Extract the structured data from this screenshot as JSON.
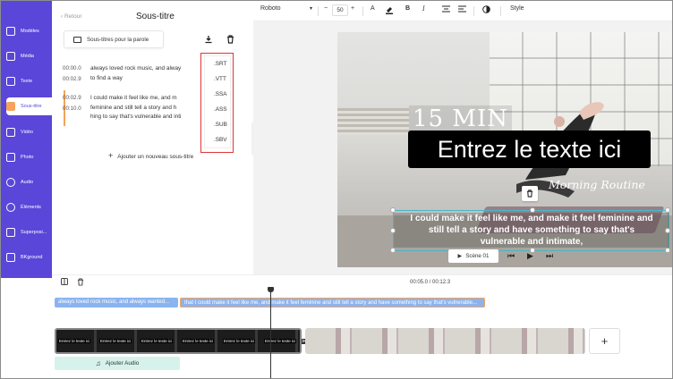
{
  "sidebar": {
    "items": [
      {
        "label": "Modèles",
        "icon": "template-icon"
      },
      {
        "label": "Média",
        "icon": "media-icon"
      },
      {
        "label": "Texte",
        "icon": "text-icon"
      },
      {
        "label": "Sous-titre",
        "icon": "subtitle-icon",
        "active": true
      },
      {
        "label": "Vidéo",
        "icon": "video-icon"
      },
      {
        "label": "Photo",
        "icon": "photo-icon"
      },
      {
        "label": "Audio",
        "icon": "audio-icon"
      },
      {
        "label": "Éléments",
        "icon": "elements-icon"
      },
      {
        "label": "Superposi...",
        "icon": "overlay-icon"
      },
      {
        "label": "BKground",
        "icon": "background-icon"
      },
      {
        "label": "Outils",
        "icon": "tools-icon"
      }
    ]
  },
  "panel": {
    "back_label": "Retour",
    "title": "Sous-titre",
    "speech_button": "Sous-titres pour la parole",
    "entries": [
      {
        "start": "00:00.0",
        "end": "00:02.9",
        "lines": [
          "always loved rock music, and alway",
          "to find a way"
        ]
      },
      {
        "start": "00:02.9",
        "end": "00:10.0",
        "lines": [
          "I could make it feel like me, and m",
          "feminine and still tell a story and h",
          "hing to say that's vulnerable and inti"
        ]
      }
    ],
    "export_formats": [
      ".SRT",
      ".VTT",
      ".SSA",
      ".ASS",
      ".SUB",
      ".SBV"
    ],
    "add_subtitle": "Ajouter un nouveau sous-titre"
  },
  "toolbar": {
    "font": "Roboto",
    "font_size": "50",
    "minus": "−",
    "plus": "+",
    "text_color": "A",
    "bold": "B",
    "italic": "I",
    "style_label": "Style"
  },
  "canvas": {
    "title_text": "15 MIN",
    "placeholder_text": "Entrez le texte ici",
    "routine_text": "Morning Routine",
    "caption_lines": [
      "I could make it feel like me, and make it feel feminine and",
      "still tell a story and have something to say that's",
      "vulnerable and intimate,"
    ],
    "scene_label": "Scène 01"
  },
  "timeline": {
    "time": "00:05.0 / 00:12.3",
    "subtitle_clips": [
      "always loved rock music, and always wanted...",
      "that I could make it feel like me, and make it feel feminine and still tell a story and have something to say that's vulnerable..."
    ],
    "thumb_label": "Entrez le texte ici",
    "add_audio": "Ajouter Audio"
  },
  "colors": {
    "sidebar_bg": "#5a46d8",
    "accent_orange": "#f5a35a",
    "highlight_red": "#e13535",
    "subtitle_track_blue": "#8ab4f0",
    "audio_track": "#d6f2ea"
  }
}
